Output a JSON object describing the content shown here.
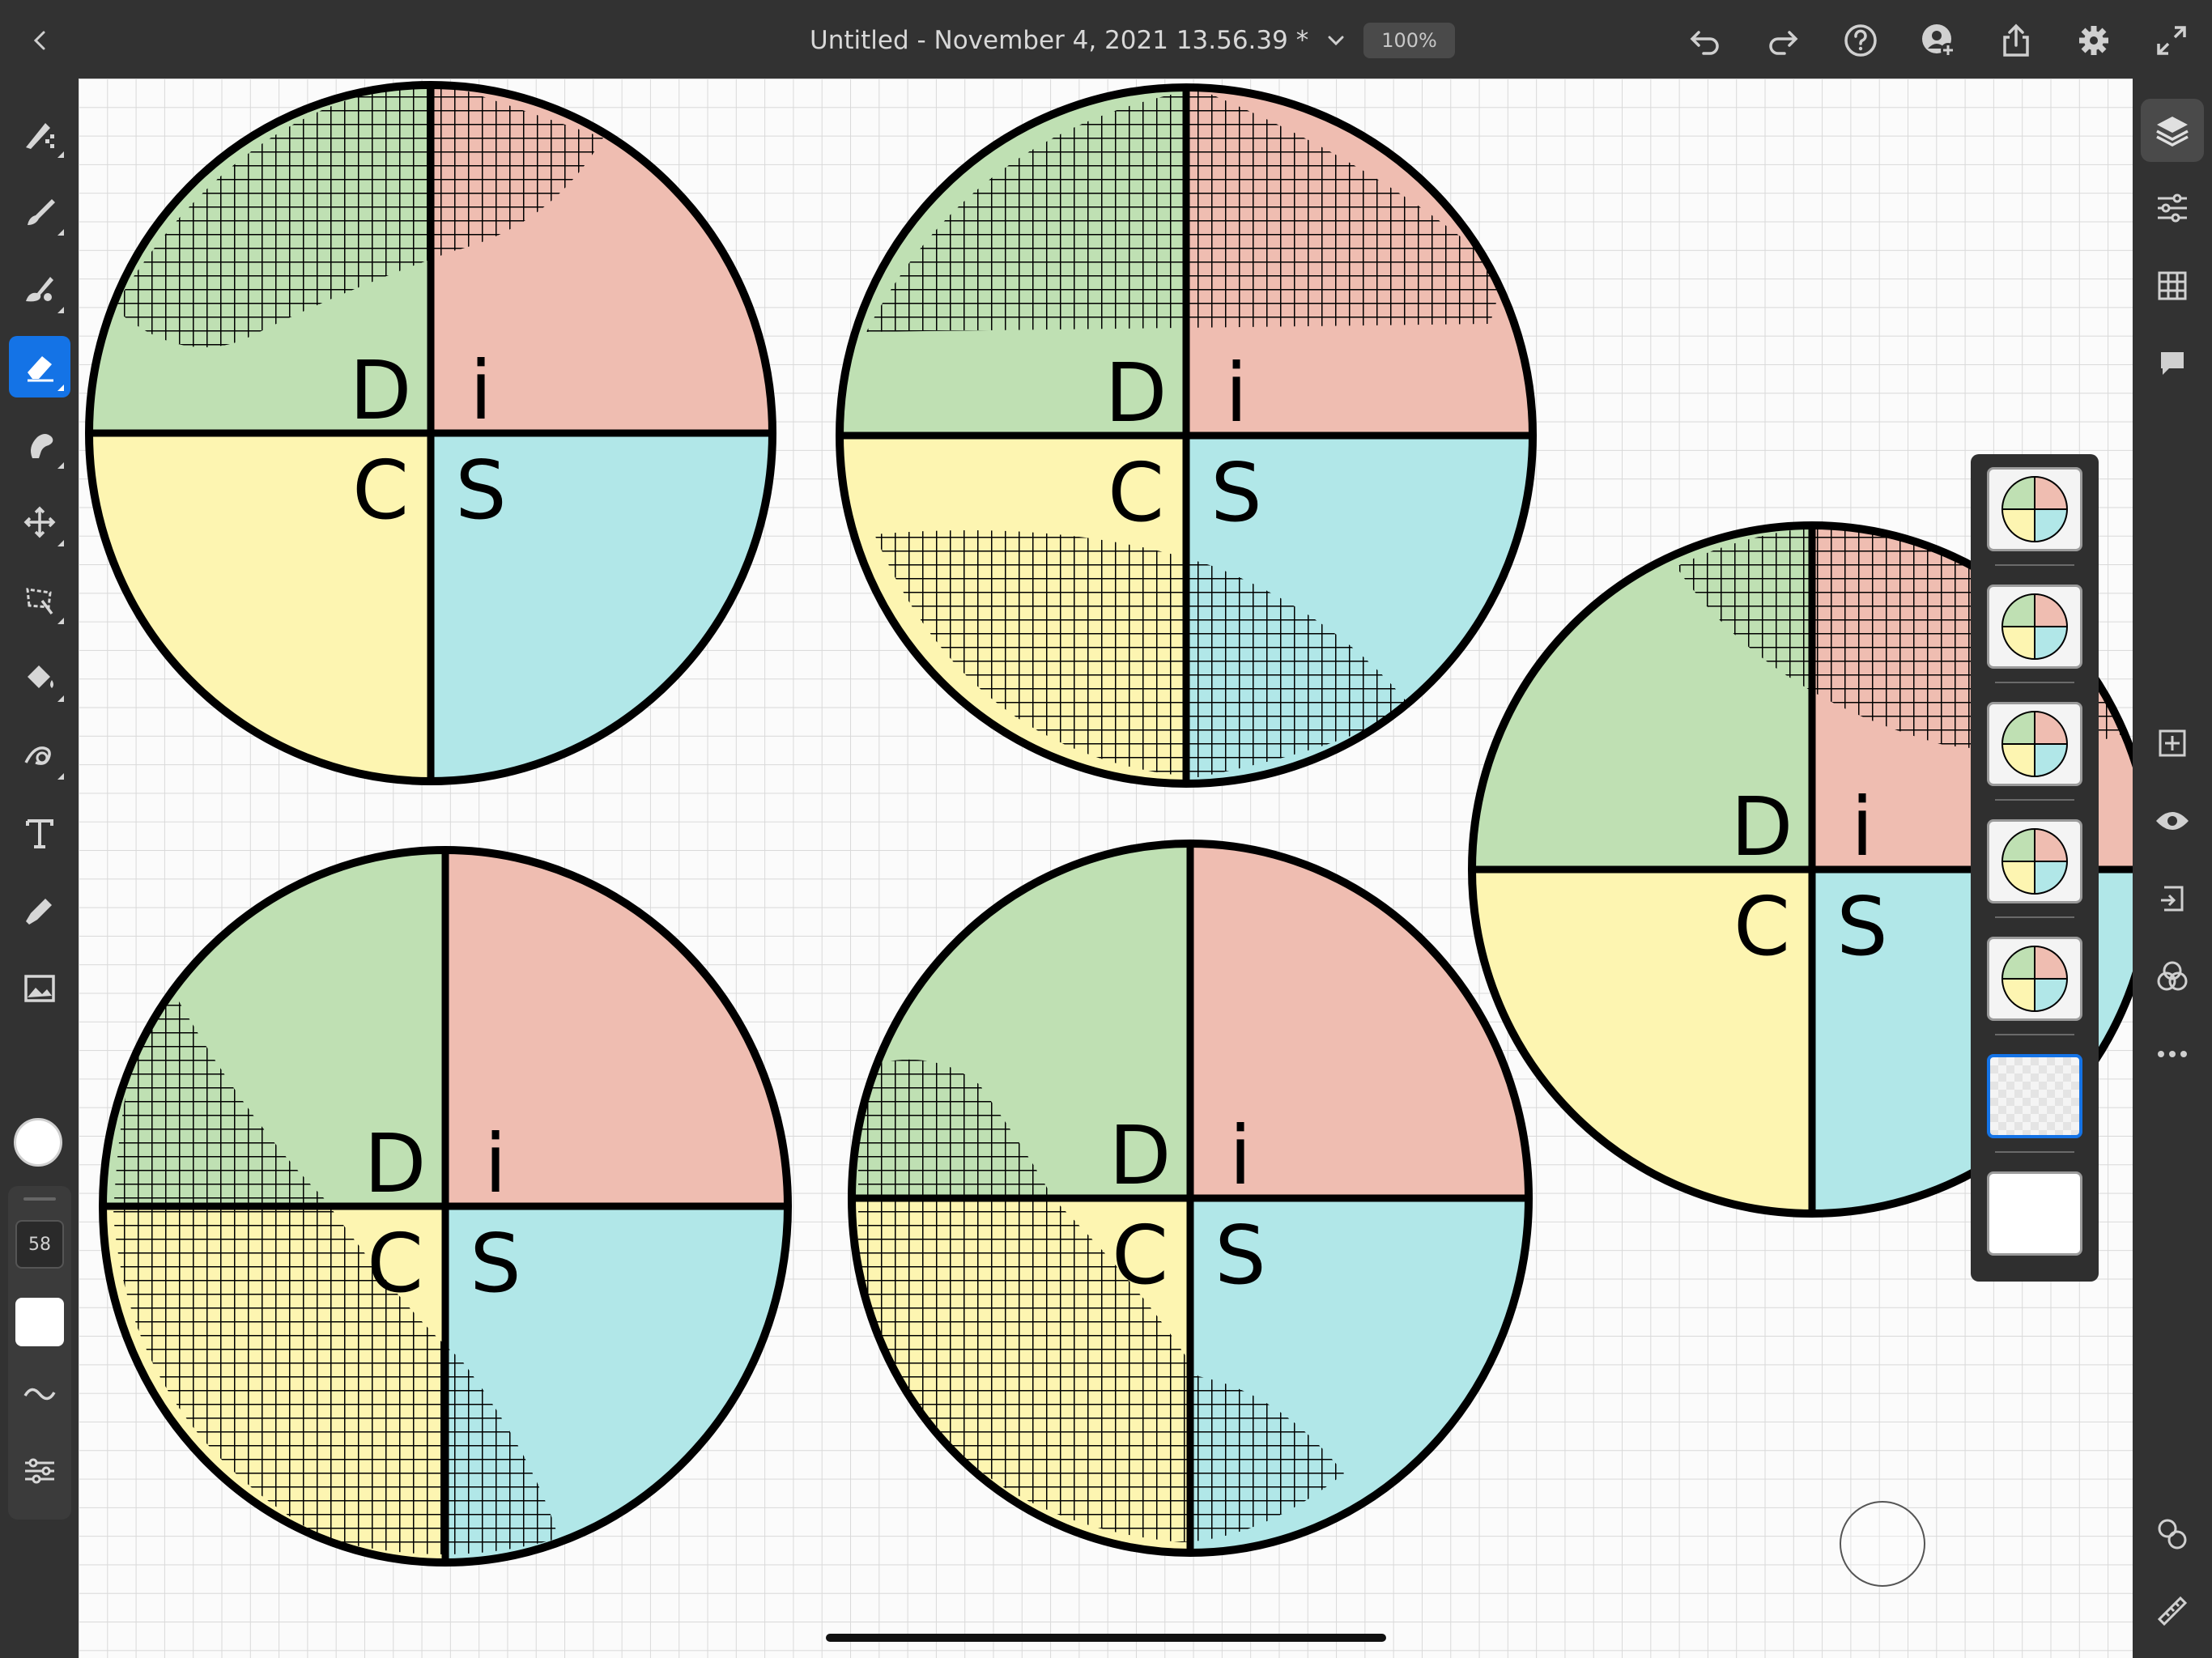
{
  "app": {
    "document_title": "Untitled - November 4, 2021 13.56.39 *",
    "zoom": "100%"
  },
  "toolbar_left": {
    "tools": [
      "pixel-brush",
      "live-brush",
      "vector-brush",
      "eraser",
      "smudge",
      "transform",
      "selection",
      "fill",
      "liquify",
      "text",
      "eyedropper",
      "image",
      "color"
    ],
    "active_tool": "eraser",
    "brush_size": "58"
  },
  "toolbar_right": {
    "tools": [
      "layers",
      "layer-properties",
      "grid",
      "comments",
      "add-layer",
      "visibility",
      "merge-down",
      "blend-mode",
      "more"
    ]
  },
  "layers": {
    "count": 7,
    "selected_index": 5
  },
  "canvas": {
    "disc_labels": {
      "d": "D",
      "i": "i",
      "c": "C",
      "s": "S"
    },
    "quadrant_colors": {
      "d": "#bfe0b3",
      "i": "#efbdb1",
      "c": "#fdf5b1",
      "s": "#b1e7e8"
    }
  }
}
